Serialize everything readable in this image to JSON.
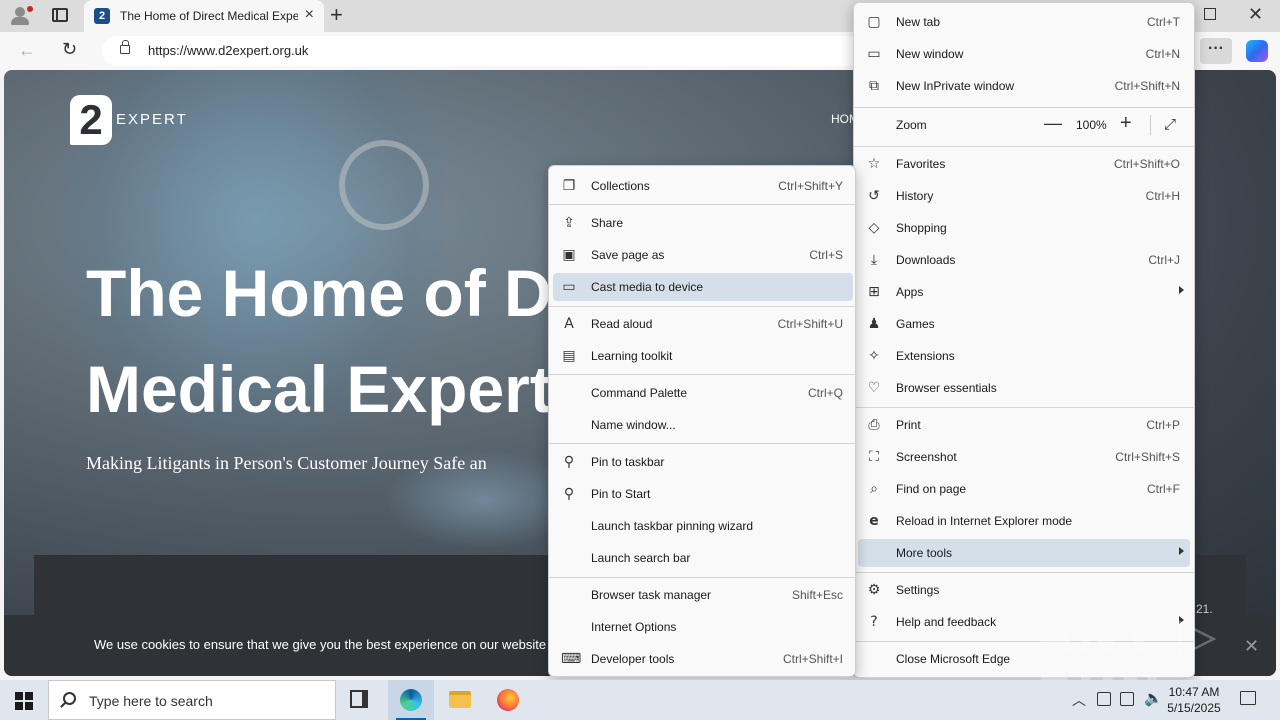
{
  "browser": {
    "tab": {
      "title": "The Home of Direct Medical Expe",
      "favicon_letter": "2"
    },
    "url": "https://www.d2expert.org.uk",
    "more_label": "···"
  },
  "page": {
    "logo_mark": "2",
    "logo_word": "EXPERT",
    "nav_home": "HOM",
    "hero_title": "The Home of Di\nMedical Experts",
    "hero_title_line1": "The Home of Di",
    "hero_title_line2": "Medical Experts",
    "hero_sub": "Making Litigants in Person's Customer Journey Safe an",
    "band_fragment": "21.",
    "cookie_text": "We use cookies to ensure that we give you the best experience on our website",
    "cookie_close": "✕"
  },
  "edge_menu": {
    "items": [
      {
        "icon": "new-tab-icon",
        "label": "New tab",
        "shortcut": "Ctrl+T"
      },
      {
        "icon": "new-window-icon",
        "label": "New window",
        "shortcut": "Ctrl+N"
      },
      {
        "icon": "inprivate-icon",
        "label": "New InPrivate window",
        "shortcut": "Ctrl+Shift+N"
      },
      {
        "icon": "",
        "label": "Zoom",
        "shortcut": ""
      },
      {
        "icon": "star-icon",
        "label": "Favorites",
        "shortcut": "Ctrl+Shift+O"
      },
      {
        "icon": "history-icon",
        "label": "History",
        "shortcut": "Ctrl+H"
      },
      {
        "icon": "tag-icon",
        "label": "Shopping",
        "shortcut": ""
      },
      {
        "icon": "download-icon",
        "label": "Downloads",
        "shortcut": "Ctrl+J"
      },
      {
        "icon": "apps-icon",
        "label": "Apps",
        "shortcut": ""
      },
      {
        "icon": "gamepad-icon",
        "label": "Games",
        "shortcut": ""
      },
      {
        "icon": "puzzle-icon",
        "label": "Extensions",
        "shortcut": ""
      },
      {
        "icon": "heartbeat-icon",
        "label": "Browser essentials",
        "shortcut": ""
      },
      {
        "icon": "printer-icon",
        "label": "Print",
        "shortcut": "Ctrl+P"
      },
      {
        "icon": "screenshot-icon",
        "label": "Screenshot",
        "shortcut": "Ctrl+Shift+S"
      },
      {
        "icon": "find-icon",
        "label": "Find on page",
        "shortcut": "Ctrl+F"
      },
      {
        "icon": "ie-icon",
        "label": "Reload in Internet Explorer mode",
        "shortcut": ""
      },
      {
        "icon": "",
        "label": "More tools",
        "shortcut": ""
      },
      {
        "icon": "gear-icon",
        "label": "Settings",
        "shortcut": ""
      },
      {
        "icon": "help-icon",
        "label": "Help and feedback",
        "shortcut": ""
      },
      {
        "icon": "",
        "label": "Close Microsoft Edge",
        "shortcut": ""
      }
    ],
    "zoom": {
      "value": "100%",
      "minus": "—",
      "plus": "+"
    }
  },
  "more_tools_menu": {
    "items": [
      {
        "icon": "collections-icon",
        "label": "Collections",
        "shortcut": "Ctrl+Shift+Y"
      },
      {
        "icon": "share-icon",
        "label": "Share",
        "shortcut": ""
      },
      {
        "icon": "save-icon",
        "label": "Save page as",
        "shortcut": "Ctrl+S"
      },
      {
        "icon": "cast-icon",
        "label": "Cast media to device",
        "shortcut": ""
      },
      {
        "icon": "read-aloud-icon",
        "label": "Read aloud",
        "shortcut": "Ctrl+Shift+U"
      },
      {
        "icon": "learning-icon",
        "label": "Learning toolkit",
        "shortcut": ""
      },
      {
        "icon": "",
        "label": "Command Palette",
        "shortcut": "Ctrl+Q"
      },
      {
        "icon": "",
        "label": "Name window...",
        "shortcut": ""
      },
      {
        "icon": "pin-icon",
        "label": "Pin to taskbar",
        "shortcut": ""
      },
      {
        "icon": "pin-icon",
        "label": "Pin to Start",
        "shortcut": ""
      },
      {
        "icon": "",
        "label": "Launch taskbar pinning wizard",
        "shortcut": ""
      },
      {
        "icon": "",
        "label": "Launch search bar",
        "shortcut": ""
      },
      {
        "icon": "",
        "label": "Browser task manager",
        "shortcut": "Shift+Esc"
      },
      {
        "icon": "",
        "label": "Internet Options",
        "shortcut": ""
      },
      {
        "icon": "devtools-icon",
        "label": "Developer tools",
        "shortcut": "Ctrl+Shift+I"
      }
    ]
  },
  "taskbar": {
    "search_placeholder": "Type here to search",
    "time": "10:47 AM",
    "date": "5/15/2025"
  },
  "watermark": "ANY ▷ RUN"
}
